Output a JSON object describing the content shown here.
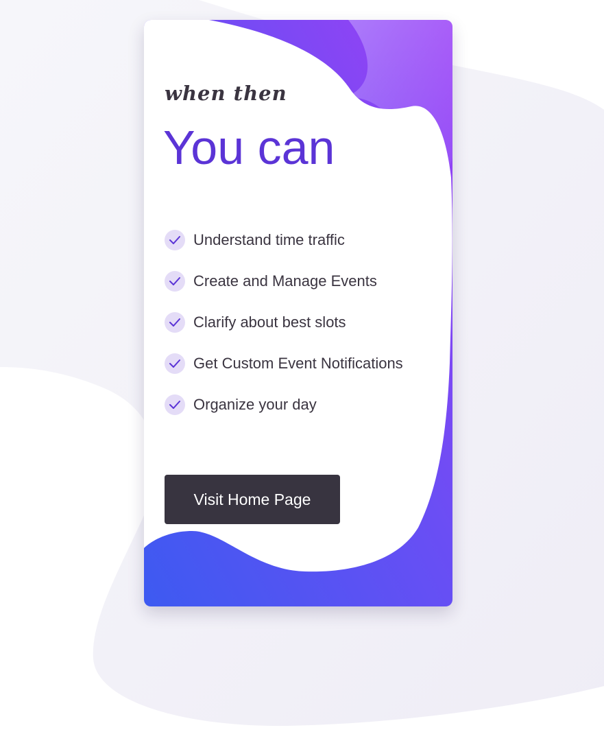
{
  "card": {
    "kicker": "when then",
    "title": "You can",
    "features": [
      "Understand time traffic",
      "Create and Manage Events",
      "Clarify about best slots",
      "Get Custom Event Notifications",
      "Organize your day"
    ],
    "cta_label": "Visit Home Page"
  },
  "icons": {
    "feature_icon": "check-icon"
  },
  "colors": {
    "accent": "#5b34d6",
    "gradient_start": "#3d5af1",
    "gradient_end": "#9e3ff5",
    "button_bg": "#383440",
    "text": "#3a3440",
    "check_bg": "#e4dcf7"
  }
}
